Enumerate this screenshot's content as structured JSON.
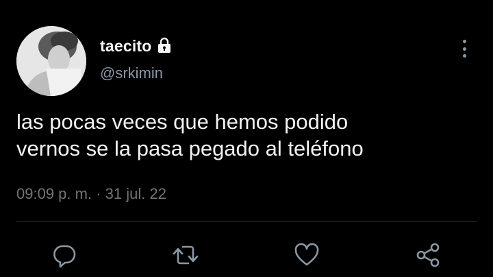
{
  "user": {
    "display_name": "taecito",
    "handle": "@srkimin",
    "locked_icon": "lock-icon",
    "avatar": "profile-avatar"
  },
  "tweet": {
    "text_lines": [
      "las pocas veces que hemos podido",
      "vernos se la pasa pegado al teléfono"
    ],
    "time": "09:09 p. m.",
    "separator": "·",
    "date": "31 jul. 22"
  },
  "actions": [
    {
      "name": "reply",
      "icon": "reply-icon"
    },
    {
      "name": "retweet",
      "icon": "retweet-icon"
    },
    {
      "name": "like",
      "icon": "heart-icon"
    },
    {
      "name": "share",
      "icon": "share-icon"
    }
  ],
  "menu": {
    "icon": "more-vertical-icon"
  },
  "colors": {
    "background": "#000000",
    "text": "#f2f2f2",
    "secondary_text": "#71767b",
    "divider": "#2f3336"
  }
}
